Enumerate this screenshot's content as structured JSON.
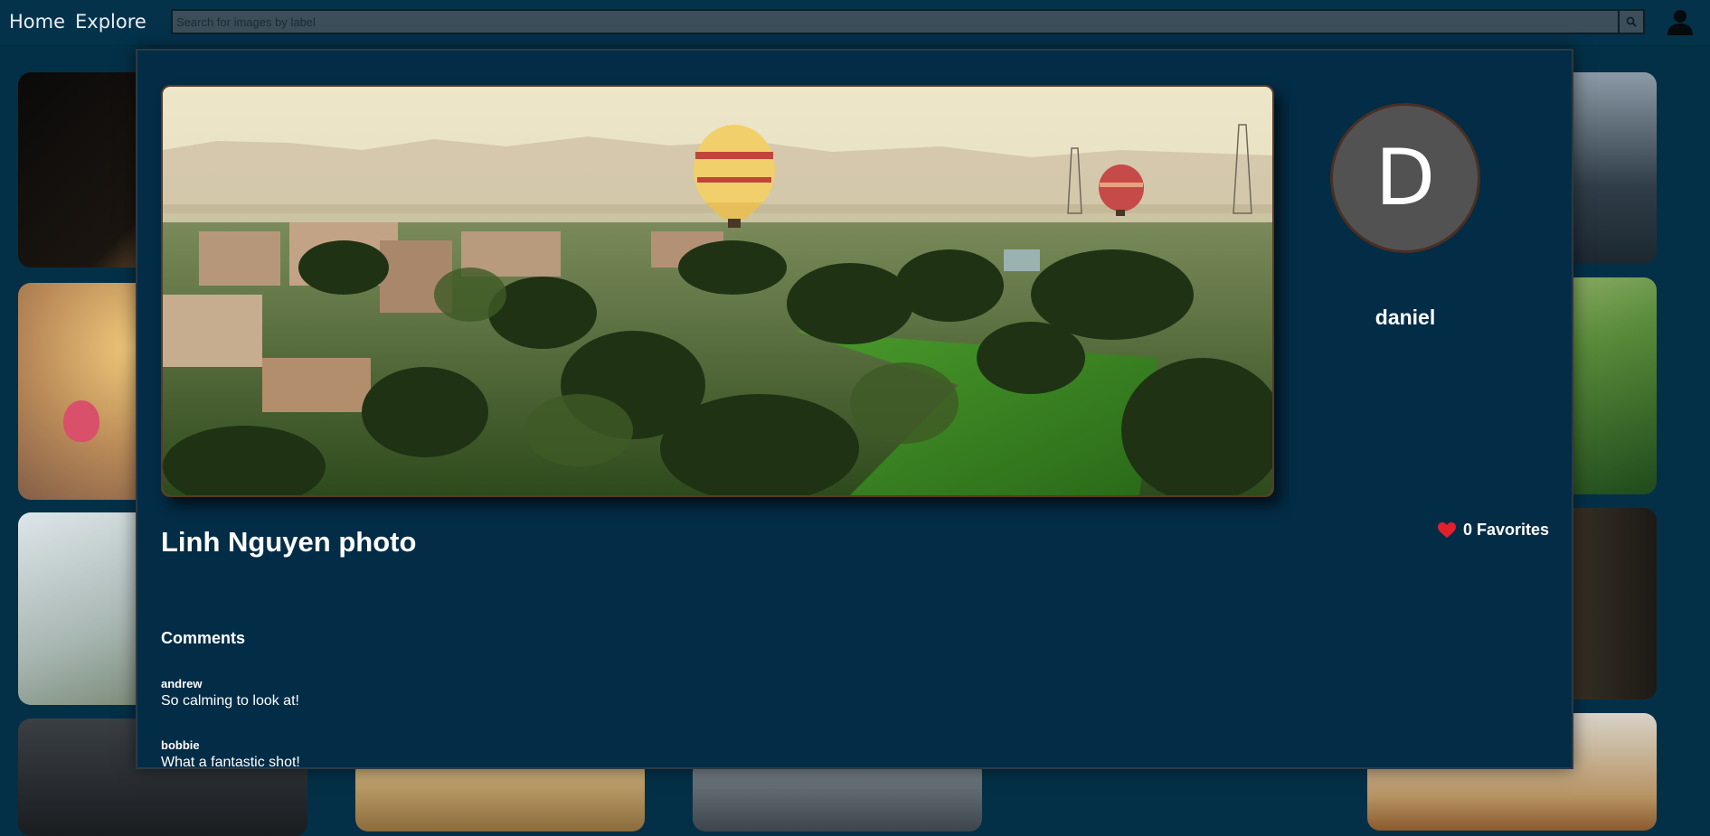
{
  "nav": {
    "home": "Home",
    "explore": "Explore"
  },
  "search": {
    "placeholder": "Search for images by label",
    "icon": "search-icon"
  },
  "header_user_icon": "user-icon",
  "modal": {
    "photo_title": "Linh Nguyen photo",
    "owner": {
      "avatar_letter": "D",
      "username": "daniel"
    },
    "favorites": {
      "count_label": "0 Favorites",
      "heart_color": "#e2202c"
    },
    "comments_heading": "Comments",
    "comments": [
      {
        "author": "andrew",
        "text": "So calming to look at!"
      },
      {
        "author": "bobbie",
        "text": "What a fantastic shot!"
      }
    ]
  },
  "colors": {
    "background": "#043047",
    "modal": "#032c46",
    "avatar": "#525252"
  }
}
